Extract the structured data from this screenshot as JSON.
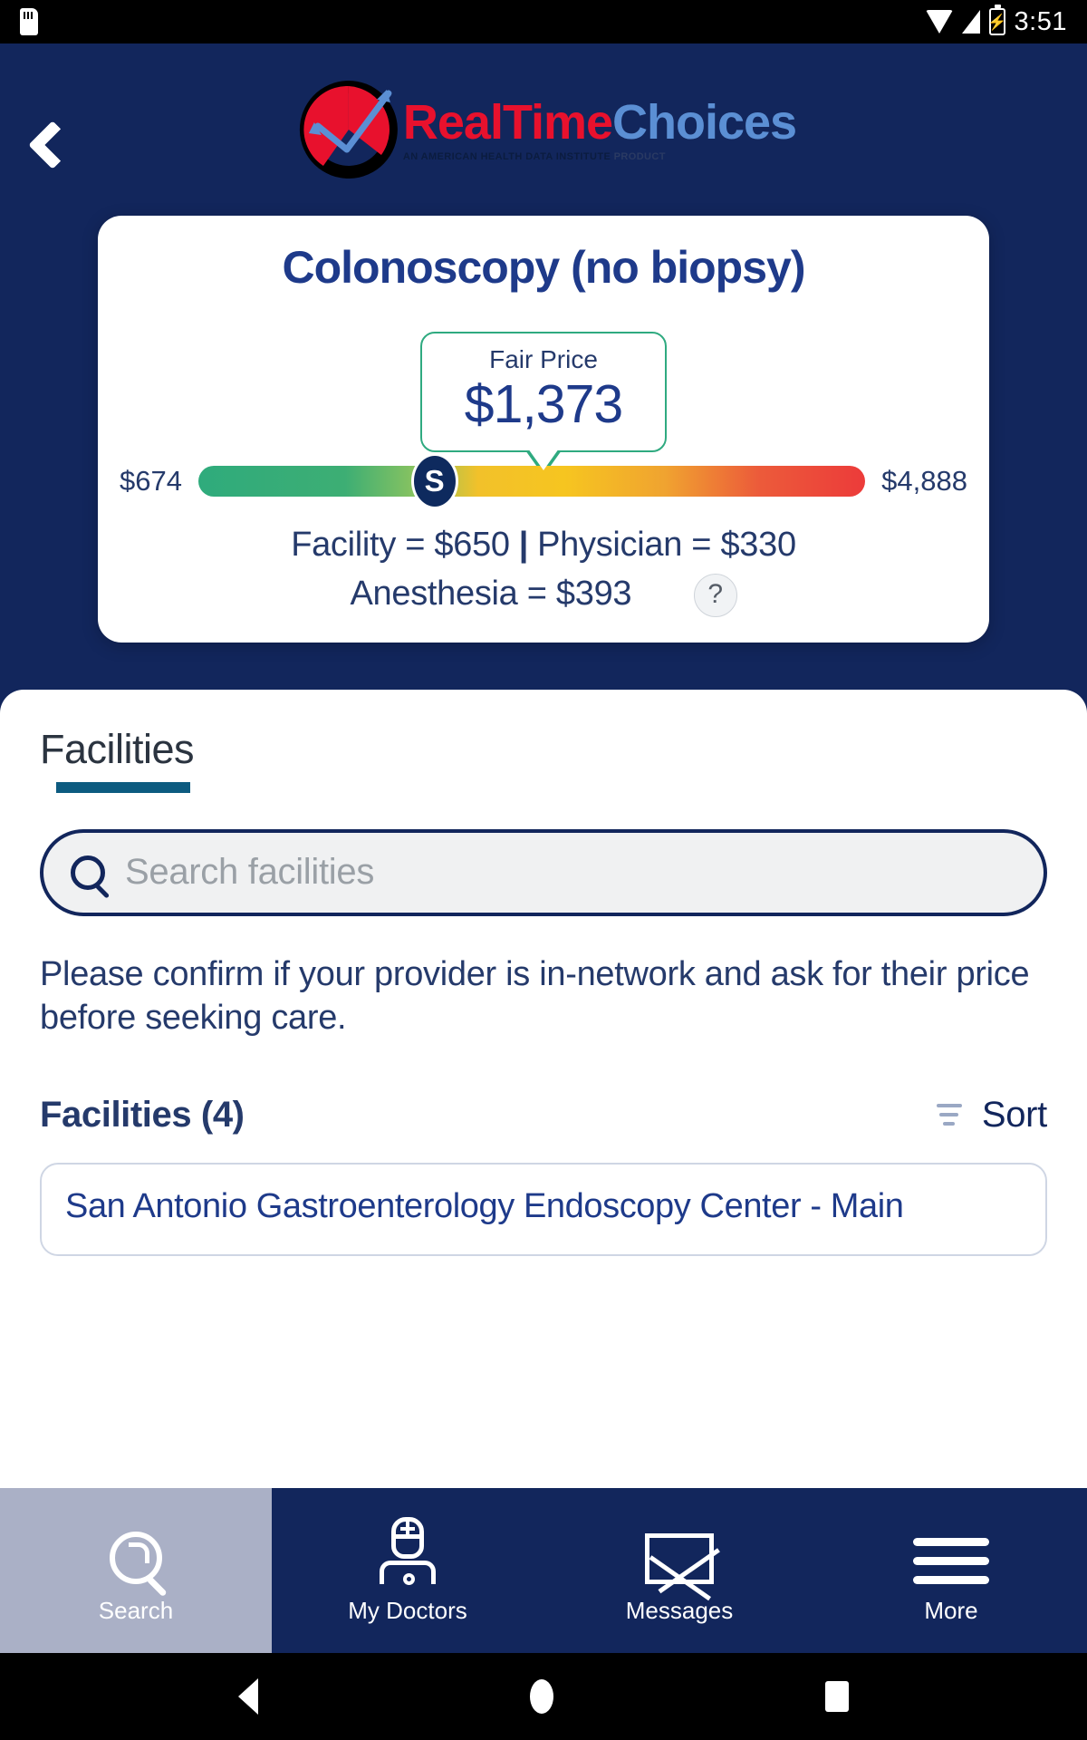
{
  "status_bar": {
    "time": "3:51",
    "icons": [
      "sdcard-icon",
      "wifi-icon",
      "signal-icon",
      "battery-charging-icon"
    ]
  },
  "header": {
    "back_icon": "chevron-left-icon",
    "logo": {
      "brand_part1": "RealTime",
      "brand_part2": "Choices",
      "tagline_strong": "AN AMERICAN HEALTH DATA INSTITUTE",
      "tagline_light": "PRODUCT",
      "color_red": "#e8112d",
      "color_blue": "#5b8fd4"
    }
  },
  "price_card": {
    "procedure_title": "Colonoscopy (no biopsy)",
    "fair_price_label": "Fair Price",
    "fair_price_value": "$1,373",
    "range_min": "$674",
    "range_max": "$4,888",
    "knob_symbol": "S",
    "breakdown": {
      "facility": "Facility = $650",
      "separator": "|",
      "physician": "Physician = $330",
      "anesthesia": "Anesthesia = $393",
      "help_icon_label": "?"
    }
  },
  "sheet": {
    "tab_title": "Facilities",
    "search": {
      "placeholder": "Search facilities",
      "value": "",
      "icon": "search-icon"
    },
    "notice": "Please confirm if your provider is in-network and ask for their price before seeking care.",
    "list_header": {
      "count_label": "Facilities (4)",
      "sort_label": "Sort",
      "sort_icon": "sort-icon"
    },
    "facilities": [
      {
        "name": "San Antonio Gastroenterology Endoscopy Center - Main"
      }
    ]
  },
  "tabbar": {
    "items": [
      {
        "label": "Search",
        "icon": "search-icon",
        "active": true
      },
      {
        "label": "My Doctors",
        "icon": "doctor-icon",
        "active": false
      },
      {
        "label": "Messages",
        "icon": "envelope-icon",
        "active": false
      },
      {
        "label": "More",
        "icon": "hamburger-icon",
        "active": false
      }
    ]
  },
  "android_navbar": {
    "back": "back-triangle-icon",
    "home": "home-circle-icon",
    "recents": "recents-square-icon"
  },
  "colors": {
    "brand_navy": "#12265c",
    "accent_teal": "#2faa80",
    "tab_underline": "#0d5b80",
    "active_tab_bg": "#aab0c6"
  }
}
